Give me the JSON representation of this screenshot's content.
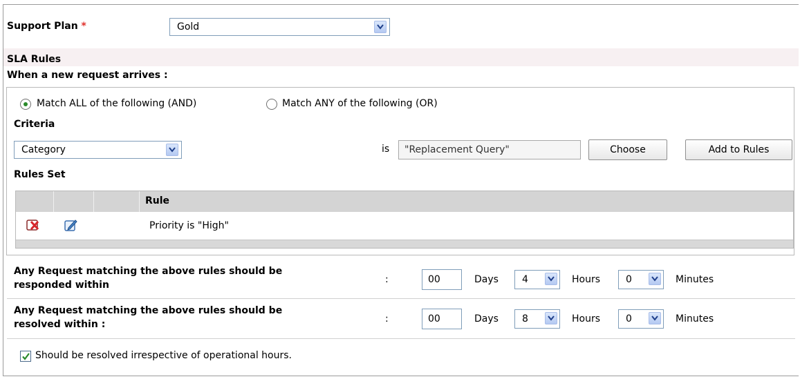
{
  "support_plan": {
    "label": "Support Plan",
    "required_mark": "*",
    "value": "Gold"
  },
  "sla": {
    "title": "SLA Rules",
    "when_label": "When a new request arrives :"
  },
  "match": {
    "all_label": "Match ALL of the following (AND)",
    "any_label": "Match ANY of the following (OR)",
    "selected": "all"
  },
  "criteria": {
    "title": "Criteria",
    "field_value": "Category",
    "is_label": "is",
    "criteria_value": "\"Replacement Query\"",
    "choose_label": "Choose",
    "add_label": "Add to Rules"
  },
  "rules_set": {
    "title": "Rules Set",
    "header_rule": "Rule",
    "rows": [
      {
        "rule": "Priority is \"High\""
      }
    ]
  },
  "response": {
    "label_line1": "Any Request matching the above rules should be",
    "label_line2": "responded within",
    "colon": ":",
    "days_value": "00",
    "days_label": "Days",
    "hours_value": "4",
    "hours_label": "Hours",
    "minutes_value": "0",
    "minutes_label": "Minutes"
  },
  "resolve": {
    "label_line1": "Any Request matching the above rules should be",
    "label_line2": "resolved within :",
    "colon": ":",
    "days_value": "00",
    "days_label": "Days",
    "hours_value": "8",
    "hours_label": "Hours",
    "minutes_value": "0",
    "minutes_label": "Minutes"
  },
  "operational": {
    "label": "Should be resolved irrespective of operational hours.",
    "checked": true
  },
  "colors": {
    "radio_selected": "#2a8a2a",
    "required": "#e0302b",
    "check": "#2a8a2a"
  }
}
